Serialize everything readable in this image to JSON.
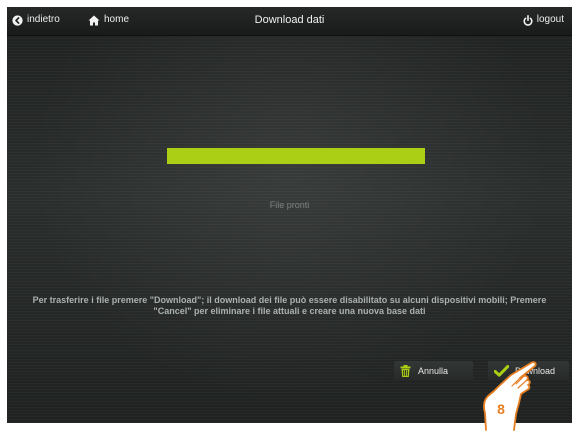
{
  "header": {
    "back_label": "indietro",
    "home_label": "home",
    "title": "Download dati",
    "logout_label": "logout"
  },
  "progress": {
    "value": 1.0,
    "color": "#aacf14"
  },
  "status": {
    "text": "File pronti"
  },
  "instructions": {
    "line1": "Per trasferire i file premere \"Download\"; il download dei file può essere disabilitato su alcuni dispositivi mobili; Premere",
    "line2": "\"Cancel\" per eliminare i file attuali e creare una nuova base dati"
  },
  "actions": {
    "cancel_label": "Annulla",
    "download_label": "Download"
  },
  "annotation": {
    "step_number": "8",
    "color": "#e67e22"
  },
  "icons": {
    "back": "back-arrow-circle-icon",
    "home": "home-icon",
    "logout": "power-icon",
    "cancel": "trash-icon",
    "download": "checkmark-icon",
    "pointer": "hand-pointer-icon"
  }
}
